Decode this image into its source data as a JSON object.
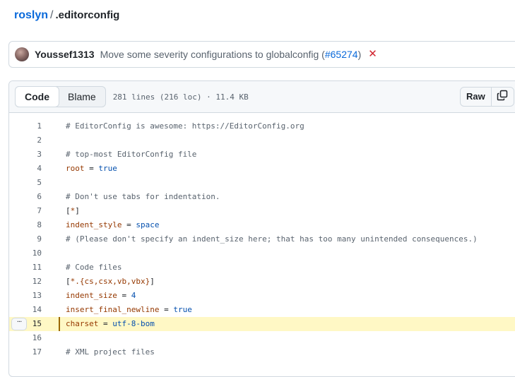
{
  "breadcrumb": {
    "repo": "roslyn",
    "separator": "/",
    "file": ".editorconfig"
  },
  "commit": {
    "author": "Youssef1313",
    "message": "Move some severity configurations to globalconfig (",
    "pr": "#65274",
    "message_end": ")",
    "status": "✕",
    "status_color": "#d1242f"
  },
  "file_header": {
    "tab_code": "Code",
    "tab_blame": "Blame",
    "meta": "281 lines (216 loc) · 11.4 KB",
    "raw_label": "Raw",
    "copy_icon": "copy-icon"
  },
  "line_menu_label": "···",
  "code_lines": [
    {
      "num": "1",
      "tokens": [
        {
          "t": "# EditorConfig is awesome: https://EditorConfig.org",
          "c": "comment"
        }
      ]
    },
    {
      "num": "2",
      "tokens": []
    },
    {
      "num": "3",
      "tokens": [
        {
          "t": "# top-most EditorConfig file",
          "c": "comment"
        }
      ]
    },
    {
      "num": "4",
      "tokens": [
        {
          "t": "root",
          "c": "key"
        },
        {
          "t": " = ",
          "c": "pl"
        },
        {
          "t": "true",
          "c": "val"
        }
      ]
    },
    {
      "num": "5",
      "tokens": []
    },
    {
      "num": "6",
      "tokens": [
        {
          "t": "# Don't use tabs for indentation.",
          "c": "comment"
        }
      ]
    },
    {
      "num": "7",
      "tokens": [
        {
          "t": "[",
          "c": "pl"
        },
        {
          "t": "*",
          "c": "key"
        },
        {
          "t": "]",
          "c": "pl"
        }
      ]
    },
    {
      "num": "8",
      "tokens": [
        {
          "t": "indent_style",
          "c": "key"
        },
        {
          "t": " = ",
          "c": "pl"
        },
        {
          "t": "space",
          "c": "val"
        }
      ]
    },
    {
      "num": "9",
      "tokens": [
        {
          "t": "# (Please don't specify an indent_size here; that has too many unintended consequences.)",
          "c": "comment"
        }
      ]
    },
    {
      "num": "10",
      "tokens": []
    },
    {
      "num": "11",
      "tokens": [
        {
          "t": "# Code files",
          "c": "comment"
        }
      ]
    },
    {
      "num": "12",
      "tokens": [
        {
          "t": "[",
          "c": "pl"
        },
        {
          "t": "*.{cs,csx,vb,vbx}",
          "c": "key"
        },
        {
          "t": "]",
          "c": "pl"
        }
      ]
    },
    {
      "num": "13",
      "tokens": [
        {
          "t": "indent_size",
          "c": "key"
        },
        {
          "t": " = ",
          "c": "pl"
        },
        {
          "t": "4",
          "c": "val"
        }
      ]
    },
    {
      "num": "14",
      "tokens": [
        {
          "t": "insert_final_newline",
          "c": "key"
        },
        {
          "t": " = ",
          "c": "pl"
        },
        {
          "t": "true",
          "c": "val"
        }
      ]
    },
    {
      "num": "15",
      "highlighted": true,
      "tokens": [
        {
          "t": "charset",
          "c": "key"
        },
        {
          "t": " = ",
          "c": "pl"
        },
        {
          "t": "utf-8-bom",
          "c": "val"
        }
      ]
    },
    {
      "num": "16",
      "tokens": []
    },
    {
      "num": "17",
      "tokens": [
        {
          "t": "# XML project files",
          "c": "comment"
        }
      ]
    }
  ],
  "colors": {
    "link": "#0969da",
    "highlight_bg": "#fff8c5",
    "highlight_bar": "#9a6700",
    "comment": "#59636e",
    "key": "#953800",
    "value": "#0550ae"
  }
}
